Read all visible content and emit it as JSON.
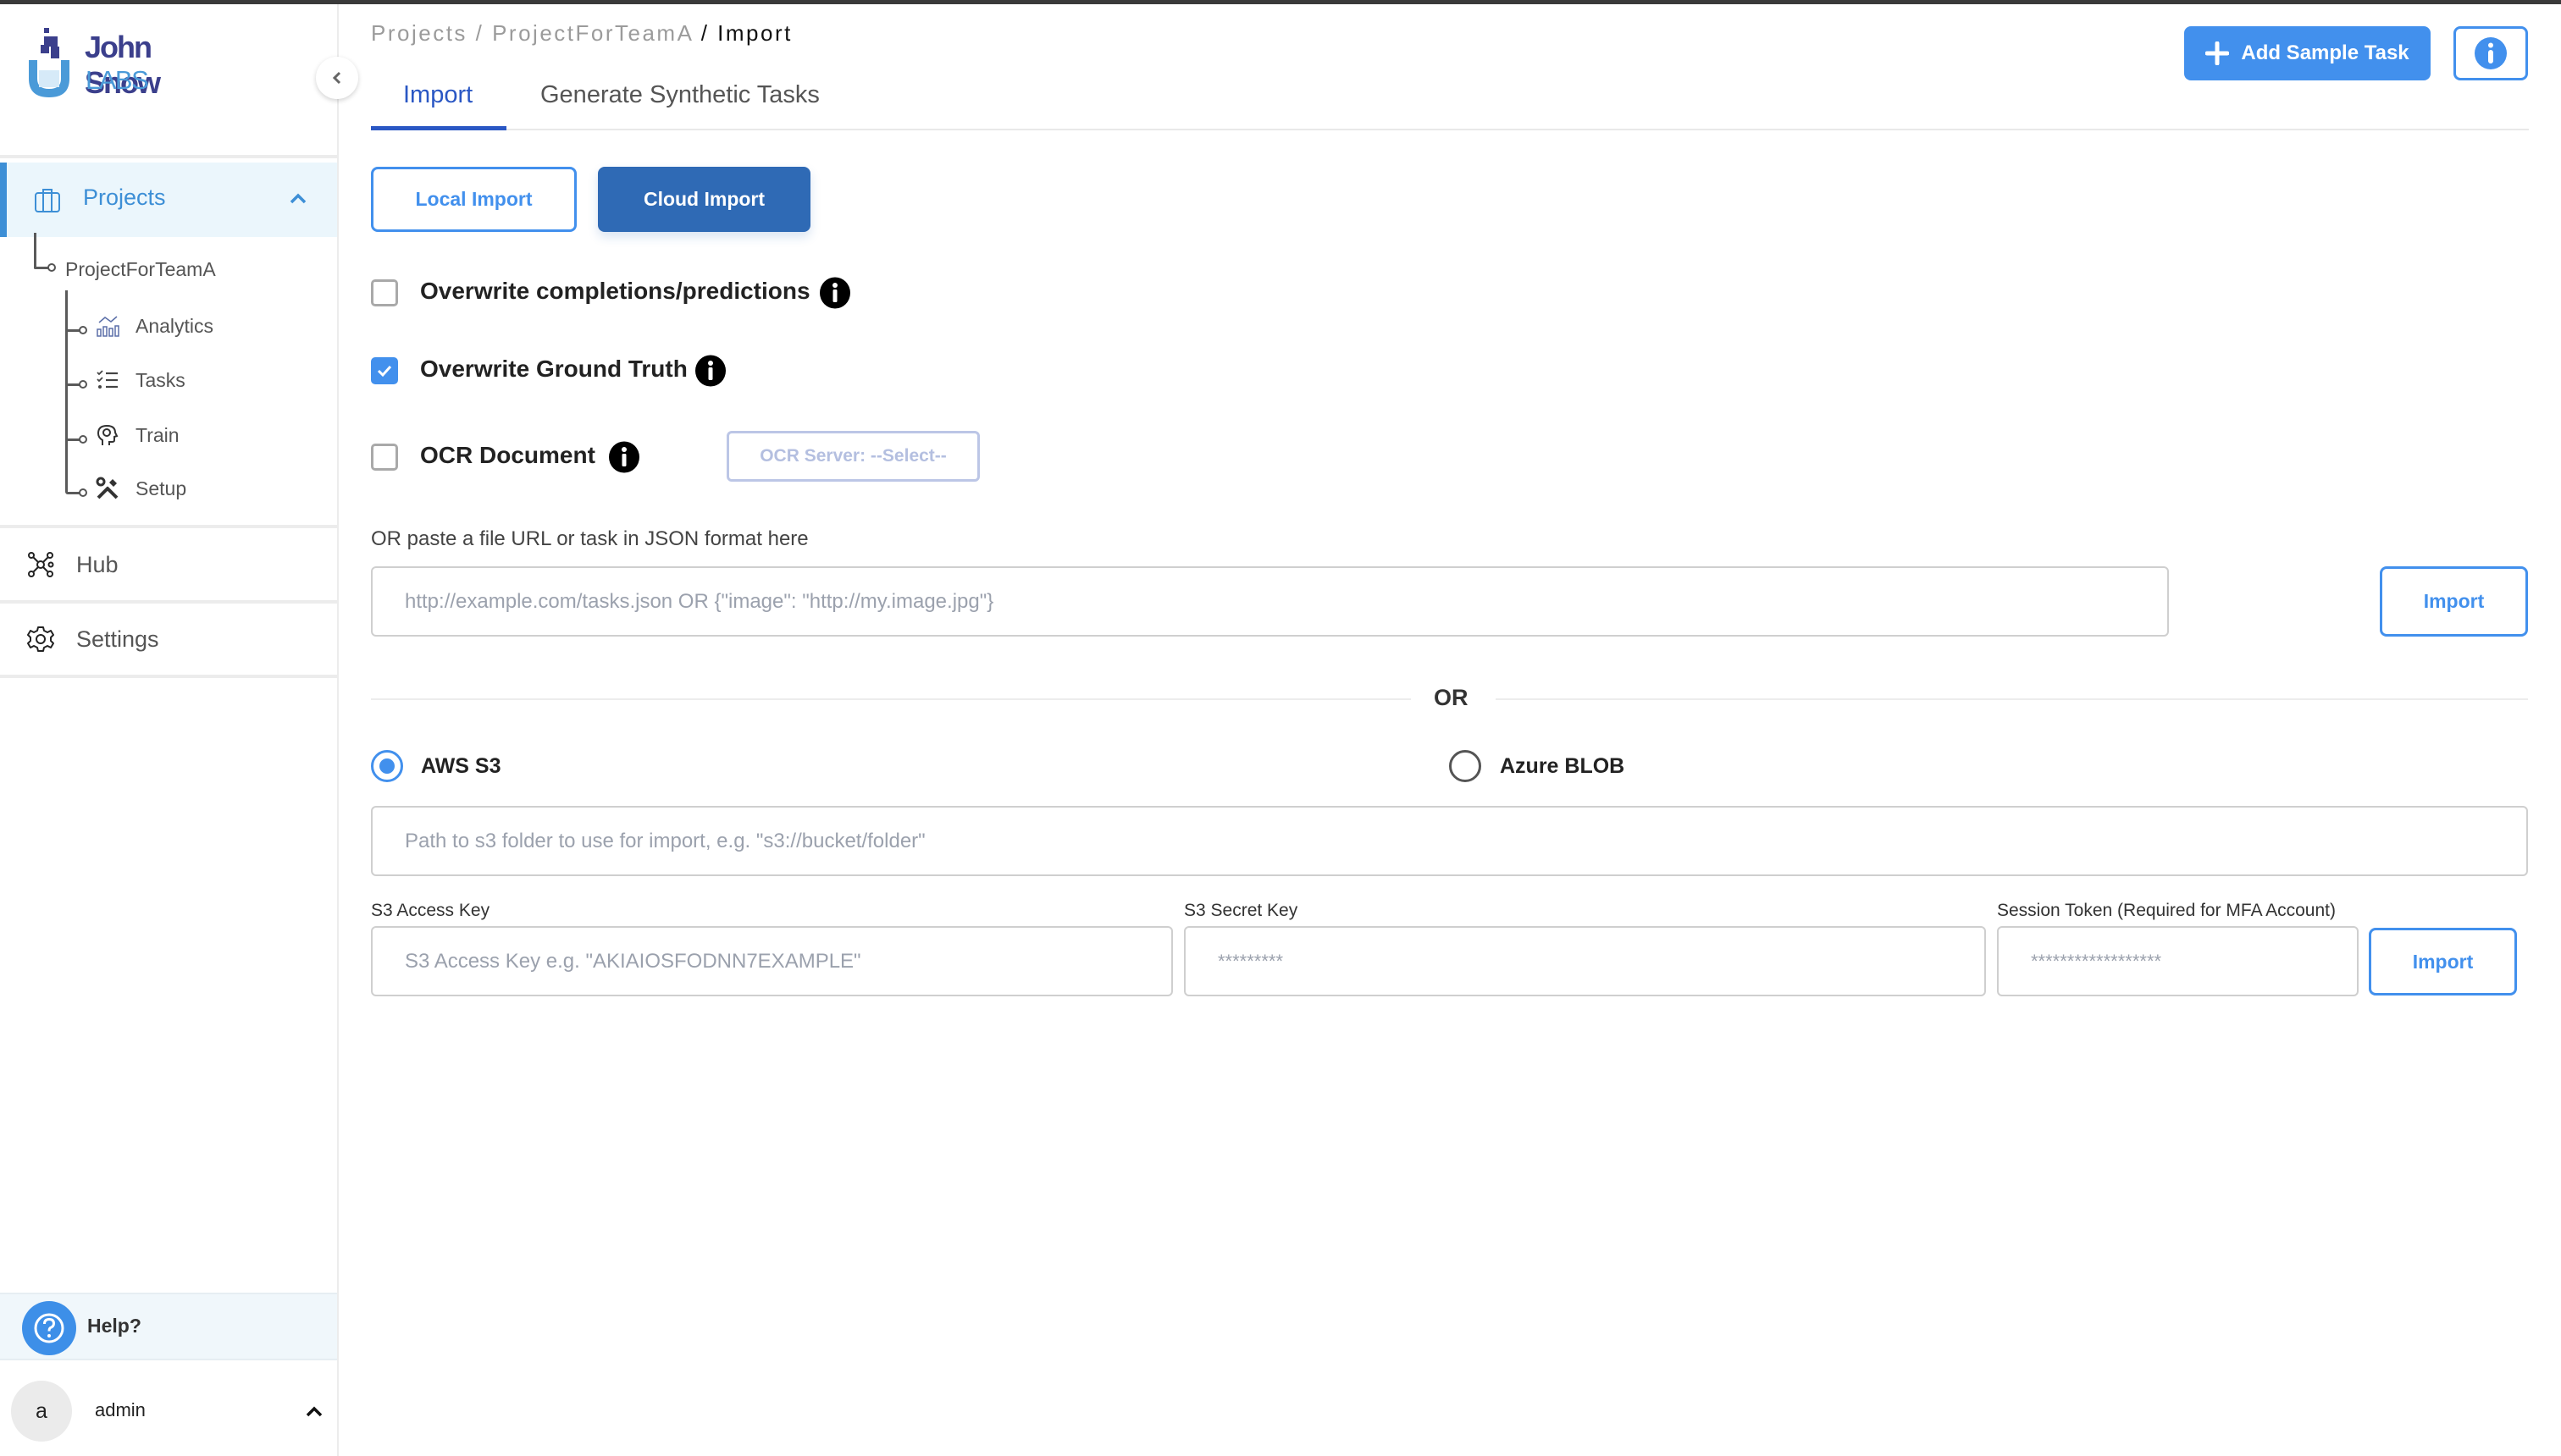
{
  "brand": {
    "name_line1": "John Snow",
    "name_line2": "LABS"
  },
  "sidebar": {
    "projects_label": "Projects",
    "project_name": "ProjectForTeamA",
    "project_children": [
      {
        "label": "Analytics",
        "icon": "analytics-icon"
      },
      {
        "label": "Tasks",
        "icon": "tasks-icon"
      },
      {
        "label": "Train",
        "icon": "train-icon"
      },
      {
        "label": "Setup",
        "icon": "setup-icon"
      }
    ],
    "hub_label": "Hub",
    "settings_label": "Settings",
    "help_label": "Help?",
    "user_initial": "a",
    "user_name": "admin"
  },
  "header": {
    "breadcrumb": {
      "projects": "Projects",
      "sep1": " / ",
      "project": "ProjectForTeamA",
      "sep2": " / ",
      "current": "Import"
    },
    "add_sample_task_label": "Add Sample Task",
    "tabs": [
      {
        "label": "Import",
        "active": true
      },
      {
        "label": "Generate Synthetic Tasks",
        "active": false
      }
    ]
  },
  "import": {
    "local_import_label": "Local Import",
    "cloud_import_label": "Cloud Import",
    "options": [
      {
        "label": "Overwrite completions/predictions",
        "checked": false
      },
      {
        "label": "Overwrite Ground Truth",
        "checked": true
      },
      {
        "label": "OCR Document",
        "checked": false
      }
    ],
    "ocr_server_label": "OCR Server: --Select--",
    "url_label": "OR paste a file URL or task in JSON format here",
    "url_placeholder": "http://example.com/tasks.json OR {\"image\": \"http://my.image.jpg\"}",
    "url_value": "",
    "import_label": "Import",
    "or_label": "OR"
  },
  "cloud": {
    "providers": [
      {
        "label": "AWS S3",
        "selected": true
      },
      {
        "label": "Azure BLOB",
        "selected": false
      }
    ],
    "s3_path_placeholder": "Path to s3 folder to use for import, e.g. \"s3://bucket/folder\"",
    "access_key_label": "S3 Access Key",
    "access_key_placeholder": "S3 Access Key e.g. \"AKIAIOSFODNN7EXAMPLE\"",
    "secret_key_label": "S3 Secret Key",
    "secret_key_placeholder": "*********",
    "session_token_label": "Session Token (Required for MFA Account)",
    "session_token_placeholder": "******************",
    "import_label": "Import"
  },
  "colors": {
    "primary": "#4290ed",
    "cloud_import": "#2f6ab5",
    "active_tab": "#2a57c4",
    "sidebar_active_bg": "#ebf6fc",
    "brand_dark": "#3b3f8c",
    "brand_light": "#4a9ad8"
  }
}
